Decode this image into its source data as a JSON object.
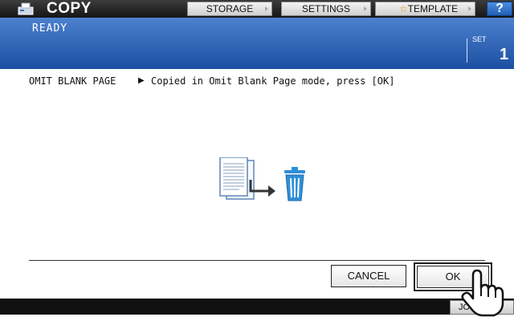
{
  "header": {
    "app_title": "COPY",
    "app_icon": "copier-icon",
    "buttons": {
      "storage": "STORAGE",
      "settings": "SETTINGS",
      "template": "TEMPLATE",
      "help": "?"
    }
  },
  "status": {
    "text": "READY",
    "set_label": "SET",
    "set_value": "1"
  },
  "message": {
    "label": "OMIT BLANK PAGE",
    "arrow": "▶",
    "text": "Copied in Omit Blank Page mode, press [OK]"
  },
  "illustration": {
    "icons": [
      "document-stack-icon",
      "arrow-right-icon",
      "trash-icon"
    ]
  },
  "actions": {
    "cancel": "CANCEL",
    "ok": "OK"
  },
  "bottom": {
    "job_button": "JOB S"
  },
  "colors": {
    "status_bar": "#2f66b9",
    "help_button": "#2a6fcb",
    "trash_icon": "#2f8fd8"
  }
}
